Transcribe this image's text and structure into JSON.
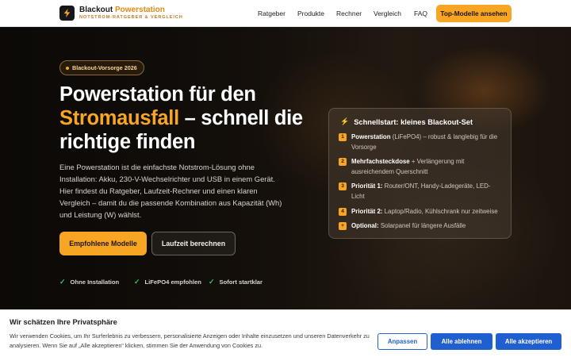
{
  "header": {
    "brand_name_part1": "Blackout",
    "brand_name_part2": "Powerstation",
    "brand_tagline": "NOTSTROM-RATGEBER & VERGLEICH",
    "nav": [
      "Ratgeber",
      "Produkte",
      "Rechner",
      "Vergleich",
      "FAQ"
    ],
    "cta": "Top-Modelle ansehen"
  },
  "hero": {
    "badge": "Blackout-Vorsorge 2026",
    "headline_1": "Powerstation für den",
    "headline_orange": "Stromausfall",
    "headline_2": " – schnell die richtige finden",
    "intro": "Eine Powerstation ist die einfachste Notstrom-Lösung ohne Installation: Akku, 230-V-Wechselrichter und USB in einem Gerät. Hier findest du Ratgeber, Laufzeit-Rechner und einen klaren Vergleich – damit du die passende Kombination aus Kapazität (Wh) und Leistung (W) wählst.",
    "btn_primary": "Empfohlene Modelle",
    "btn_secondary": "Laufzeit berechnen",
    "features": [
      "Ohne Installation",
      "LiFePO4 empfohlen",
      "Sofort startklar"
    ]
  },
  "quickstart": {
    "title": "Schnellstart: kleines Blackout-Set",
    "items": [
      {
        "num": "1",
        "bold": "Powerstation",
        "text": " (LiFePO4) – robust & langlebig für die Vorsorge"
      },
      {
        "num": "2",
        "bold": "Mehrfachsteckdose",
        "text": " + Verlängerung mit ausreichendem Querschnitt"
      },
      {
        "num": "3",
        "bold": "Priorität 1:",
        "text": " Router/ONT, Handy-Ladegeräte, LED-Licht"
      },
      {
        "num": "4",
        "bold": "Priorität 2:",
        "text": " Laptop/Radio, Kühlschrank nur zeitweise"
      },
      {
        "num": "+",
        "bold": "Optional:",
        "text": " Solarpanel für längere Ausfälle"
      }
    ]
  },
  "cookie": {
    "title": "Wir schätzen Ihre Privatsphäre",
    "text": "Wir verwenden Cookies, um Ihr Surferlebnis zu verbessern, personalisierte Anzeigen oder Inhalte einzusetzen und unseren Datenverkehr zu analysieren. Wenn Sie auf „Alle akzeptieren“ klicken, stimmen Sie der Anwendung von Cookies zu.",
    "adjust": "Anpassen",
    "reject": "Alle ablehnen",
    "accept": "Alle akzeptieren"
  },
  "colors": {
    "accent": "#f6a623",
    "cookie_button": "#1f5fd0",
    "check": "#3fbf6a"
  },
  "icons": [
    "bolt-icon",
    "check-icon"
  ]
}
